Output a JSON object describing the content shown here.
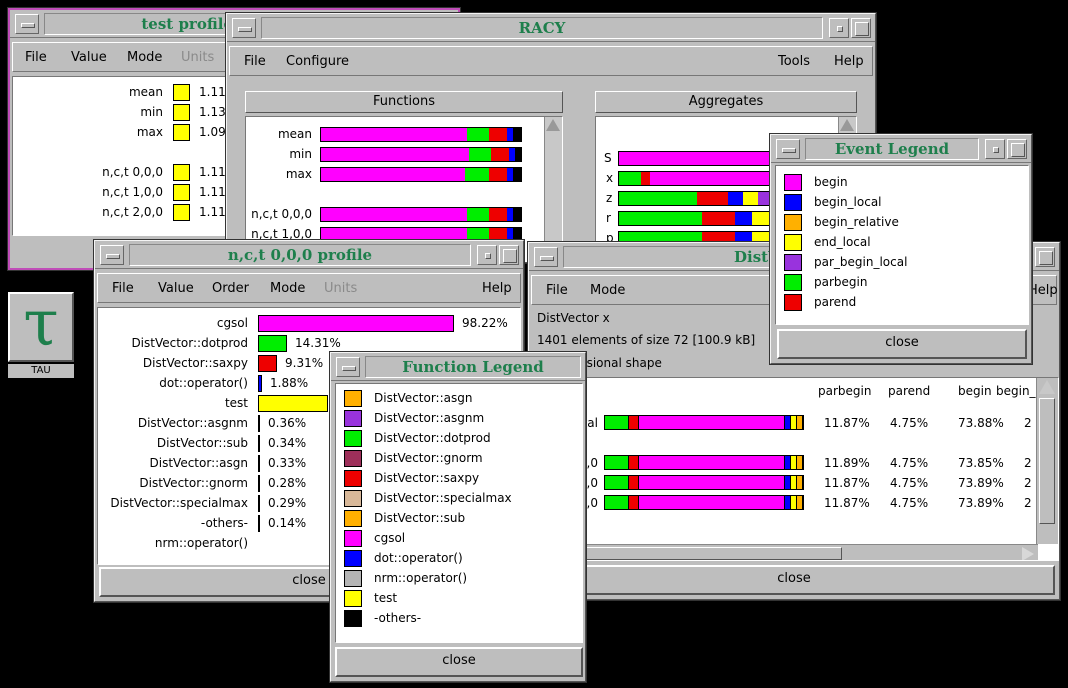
{
  "colors": {
    "begin": "#ff00ff",
    "begin_local": "#0000ff",
    "begin_relative": "#ffb000",
    "end_local": "#ffff00",
    "par_begin_local": "#9933dd",
    "parbegin": "#00ee00",
    "parend": "#ee0000",
    "gnorm": "#9e2f5a",
    "specialmax": "#d8b899",
    "nrm": "#b4b4b4",
    "others": "#000000",
    "window": "#bebebe",
    "title_text": "#1e7f4c"
  },
  "test_profile": {
    "title": "test profile",
    "menu": [
      "File",
      "Value",
      "Mode",
      "Units"
    ],
    "rows": [
      {
        "label": "mean",
        "value": "1.11"
      },
      {
        "label": "min",
        "value": "1.13"
      },
      {
        "label": "max",
        "value": "1.09"
      },
      {
        "label": "n,c,t 0,0,0",
        "value": "1.11"
      },
      {
        "label": "n,c,t 1,0,0",
        "value": "1.11"
      },
      {
        "label": "n,c,t 2,0,0",
        "value": "1.11"
      }
    ]
  },
  "tau_icon": {
    "glyph": "τ",
    "label": "TAU"
  },
  "racy": {
    "title": "RACY",
    "menu_left": [
      "File",
      "Configure"
    ],
    "menu_right": [
      "Tools",
      "Help"
    ],
    "functions_header": "Functions",
    "aggregates_header": "Aggregates",
    "function_rows": [
      "mean",
      "min",
      "max",
      "n,c,t 0,0,0",
      "n,c,t 1,0,0"
    ],
    "aggregate_rows": [
      "S",
      "x",
      "z",
      "r",
      "p"
    ]
  },
  "event_legend": {
    "title": "Event Legend",
    "items": [
      "begin",
      "begin_local",
      "begin_relative",
      "end_local",
      "par_begin_local",
      "parbegin",
      "parend"
    ],
    "close": "close"
  },
  "profile_000": {
    "title": "n,c,t 0,0,0 profile",
    "menu": [
      "File",
      "Value",
      "Order",
      "Mode",
      "Units",
      "Help"
    ],
    "rows": [
      {
        "label": "cgsol",
        "pct": "98.22%",
        "value": 98.22
      },
      {
        "label": "DistVector::dotprod",
        "pct": "14.31%",
        "value": 14.31
      },
      {
        "label": "DistVector::saxpy",
        "pct": "9.31%",
        "value": 9.31
      },
      {
        "label": "dot::operator()",
        "pct": "1.88%",
        "value": 1.88
      },
      {
        "label": "test",
        "pct": "",
        "value": 0
      },
      {
        "label": "DistVector::asgnm",
        "pct": "0.36%",
        "value": 0.36
      },
      {
        "label": "DistVector::sub",
        "pct": "0.34%",
        "value": 0.34
      },
      {
        "label": "DistVector::asgn",
        "pct": "0.33%",
        "value": 0.33
      },
      {
        "label": "DistVector::gnorm",
        "pct": "0.28%",
        "value": 0.28
      },
      {
        "label": "DistVector::specialmax",
        "pct": "0.29%",
        "value": 0.29
      },
      {
        "label": "-others-",
        "pct": "0.14%",
        "value": 0.14
      },
      {
        "label": "nrm::operator()",
        "pct": "",
        "value": 0
      }
    ],
    "close": "close"
  },
  "distvector": {
    "title": "DistVector x",
    "menu": [
      "File",
      "Mode",
      "Help"
    ],
    "info": [
      "DistVector x",
      "1401 elements of size 72 [100.9 kB]",
      "1-dimensional shape"
    ],
    "columns": [
      "parbegin",
      "parend",
      "begin",
      "begin_"
    ],
    "rows": [
      {
        "label": "total",
        "values": [
          "11.87%",
          "4.75%",
          "73.88%",
          "2"
        ]
      },
      {
        "label": "n,c,t 0,0,0",
        "values": [
          "11.89%",
          "4.75%",
          "73.85%",
          "2"
        ]
      },
      {
        "label": "n,c,t 1,0,0",
        "values": [
          "11.87%",
          "4.75%",
          "73.89%",
          "2"
        ]
      },
      {
        "label": "n,c,t 2,0,0",
        "values": [
          "11.87%",
          "4.75%",
          "73.89%",
          "2"
        ]
      }
    ],
    "close": "close"
  },
  "function_legend": {
    "title": "Function Legend",
    "items": [
      "DistVector::asgn",
      "DistVector::asgnm",
      "DistVector::dotprod",
      "DistVector::gnorm",
      "DistVector::saxpy",
      "DistVector::specialmax",
      "DistVector::sub",
      "cgsol",
      "dot::operator()",
      "nrm::operator()",
      "test",
      "-others-"
    ],
    "close": "close"
  }
}
